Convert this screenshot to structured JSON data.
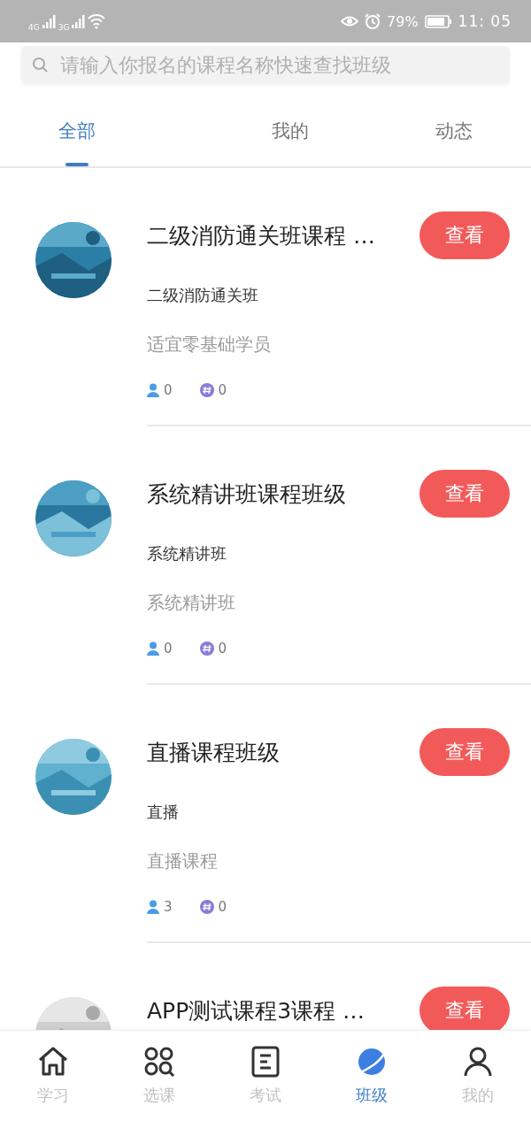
{
  "status_bar": {
    "network_1": "4G",
    "network_2": "3G",
    "battery": "79%",
    "time": "11: 05"
  },
  "search": {
    "placeholder": "请输入你报名的课程名称快速查找班级"
  },
  "tabs": [
    {
      "label": "全部",
      "selected": true
    },
    {
      "label": "我的",
      "selected": false
    },
    {
      "label": "动态",
      "selected": false
    }
  ],
  "classes": [
    {
      "title": "二级消防通关班课程 …",
      "subtitle": "二级消防通关班",
      "description": "适宜零基础学员",
      "members": "0",
      "topics": "0",
      "button": "查看"
    },
    {
      "title": "系统精讲班课程班级",
      "subtitle": "系统精讲班",
      "description": "系统精讲班",
      "members": "0",
      "topics": "0",
      "button": "查看"
    },
    {
      "title": "直播课程班级",
      "subtitle": "直播",
      "description": "直播课程",
      "members": "3",
      "topics": "0",
      "button": "查看"
    },
    {
      "title": "APP测试课程3课程 …",
      "button": "查看"
    }
  ],
  "bottom_nav": [
    {
      "kind": "home",
      "label": "学习",
      "selected": false
    },
    {
      "kind": "courses",
      "label": "选课",
      "selected": false
    },
    {
      "kind": "exam",
      "label": "考试",
      "selected": false
    },
    {
      "kind": "planet",
      "label": "班级",
      "selected": true
    },
    {
      "kind": "profile",
      "label": "我的",
      "selected": false
    }
  ]
}
